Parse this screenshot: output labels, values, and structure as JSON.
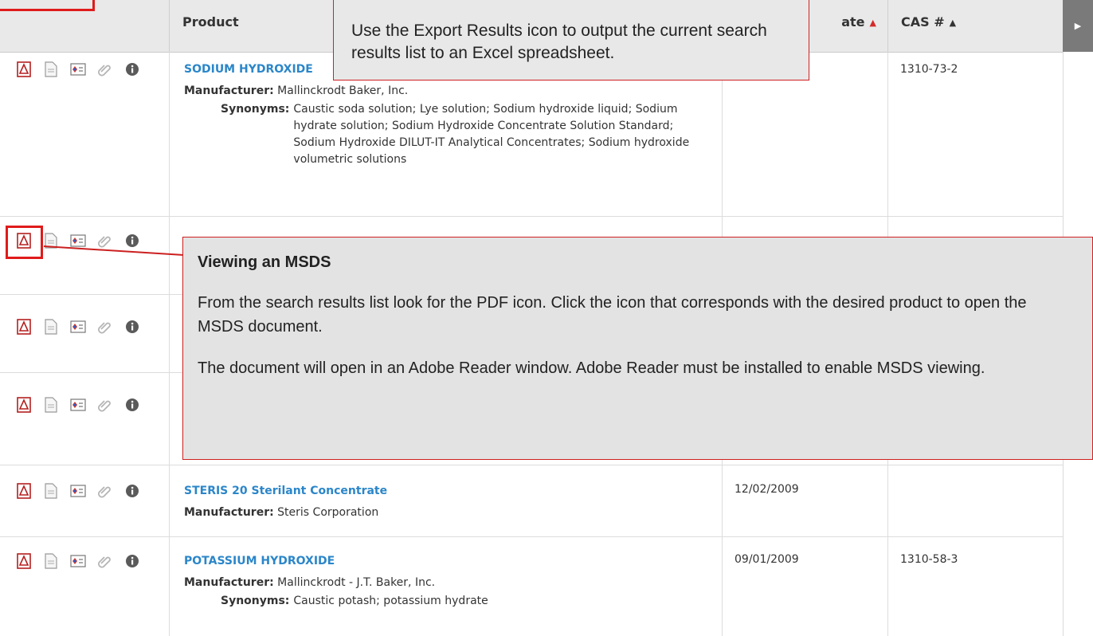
{
  "table": {
    "columns": {
      "product": "Product",
      "date_partial": "ate",
      "cas": "CAS #"
    },
    "rows": [
      {
        "name": "SODIUM HYDROXIDE",
        "manufacturer_label": "Manufacturer:",
        "manufacturer": "Mallinckrodt Baker, Inc.",
        "synonyms_label": "Synonyms:",
        "synonyms": "Caustic soda solution; Lye solution; Sodium hydroxide liquid; Sodium hydrate solution; Sodium Hydroxide Concentrate Solution Standard; Sodium Hydroxide DILUT-IT Analytical Concentrates; Sodium hydroxide volumetric solutions",
        "date": "",
        "cas": "1310-73-2"
      },
      {
        "name": "STERIS 20 Sterilant Concentrate",
        "manufacturer_label": "Manufacturer:",
        "manufacturer": "Steris Corporation",
        "date": "12/02/2009",
        "cas": ""
      },
      {
        "name": "POTASSIUM HYDROXIDE",
        "manufacturer_label": "Manufacturer:",
        "manufacturer": "Mallinckrodt - J.T. Baker, Inc.",
        "synonyms_label": "Synonyms:",
        "synonyms": "Caustic potash; potassium hydrate",
        "date": "09/01/2009",
        "cas": "1310-58-3"
      }
    ]
  },
  "icons": [
    "pdf-icon",
    "document-icon",
    "nfpa-label-icon",
    "attachment-icon",
    "info-icon"
  ],
  "callouts": {
    "export": {
      "text": "Use the Export Results icon to output the current search results list to an Excel spreadsheet."
    },
    "msds": {
      "title": "Viewing an MSDS",
      "p1": "From the search results list look for the PDF icon. Click the icon that corresponds with the desired product to open the MSDS document.",
      "p2": "The document will open in an Adobe Reader window.  Adobe Reader must be installed to enable MSDS viewing."
    }
  },
  "colors": {
    "link": "#2b86c9",
    "callout_border": "#d02020",
    "header_bg": "#e9e9e9"
  }
}
